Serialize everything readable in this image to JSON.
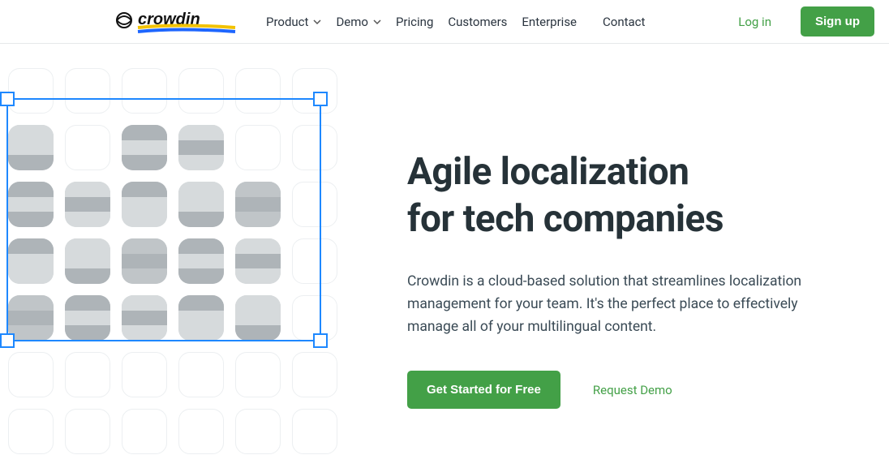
{
  "logo_text": "crowdin",
  "nav": {
    "product": "Product",
    "demo": "Demo",
    "pricing": "Pricing",
    "customers": "Customers",
    "enterprise": "Enterprise",
    "contact": "Contact"
  },
  "auth": {
    "login": "Log in",
    "signup": "Sign up"
  },
  "hero": {
    "title_line1": "Agile localization",
    "title_line2": "for tech companies",
    "description": "Crowdin is a cloud-based solution that streamlines localization management for your team. It's the perfect place to effectively manage all of your multilingual content.",
    "cta_primary": "Get Started for Free",
    "cta_secondary": "Request Demo"
  },
  "illustration": {
    "flag_positions": [
      [
        1,
        1
      ],
      [
        1,
        3
      ],
      [
        1,
        4
      ],
      [
        2,
        1
      ],
      [
        2,
        2
      ],
      [
        2,
        3
      ],
      [
        2,
        4
      ],
      [
        2,
        5
      ],
      [
        3,
        1
      ],
      [
        3,
        2
      ],
      [
        3,
        3
      ],
      [
        3,
        4
      ],
      [
        3,
        5
      ],
      [
        4,
        1
      ],
      [
        4,
        2
      ],
      [
        4,
        3
      ],
      [
        4,
        4
      ],
      [
        4,
        5
      ]
    ]
  }
}
